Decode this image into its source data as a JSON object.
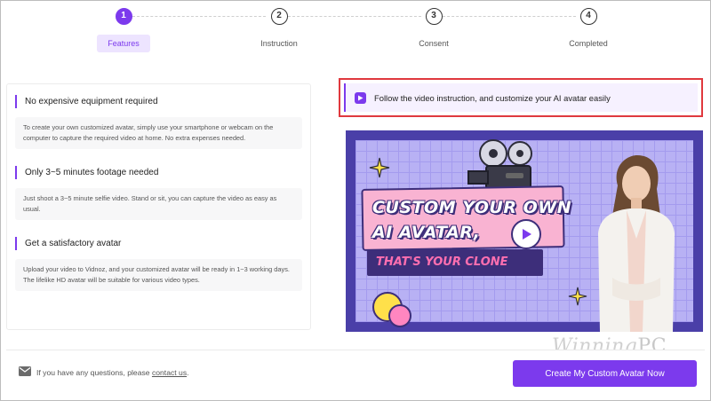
{
  "stepper": {
    "steps": [
      {
        "number": "1",
        "label": "Features",
        "active": true
      },
      {
        "number": "2",
        "label": "Instruction",
        "active": false
      },
      {
        "number": "3",
        "label": "Consent",
        "active": false
      },
      {
        "number": "4",
        "label": "Completed",
        "active": false
      }
    ]
  },
  "features": [
    {
      "title": "No expensive equipment required",
      "desc": "To create your own customized avatar, simply use your smartphone or webcam on the computer to capture the required video at home. No extra expenses needed."
    },
    {
      "title": "Only 3~5 minutes footage needed",
      "desc": "Just shoot a 3~5 minute selfie video. Stand or sit, you can capture the video as easy as usual."
    },
    {
      "title": "Get a satisfactory avatar",
      "desc": "Upload your video to Vidnoz, and your customized avatar will be ready in 1~3 working days. The lifelike HD avatar will be suitable for various video types."
    }
  ],
  "instruction": {
    "text": "Follow the video instruction, and customize your AI avatar easily",
    "icon": "play-icon"
  },
  "video": {
    "line1": "CUSTOM YOUR OWN",
    "line2": "AI AVATAR,",
    "subtitle": "THAT'S YOUR CLONE",
    "accent": "#7c3aed",
    "card_color": "#f9b3d2",
    "bg_color": "#4a3fa8"
  },
  "watermark": {
    "word": "Winning",
    "suffix": "PC"
  },
  "footer": {
    "text": "If you have any questions, please ",
    "link": "contact us",
    "after": ".",
    "cta": "Create My Custom Avatar Now",
    "icon": "mail-icon"
  },
  "colors": {
    "primary": "#7c3aed",
    "highlight_border": "#e0393e"
  }
}
